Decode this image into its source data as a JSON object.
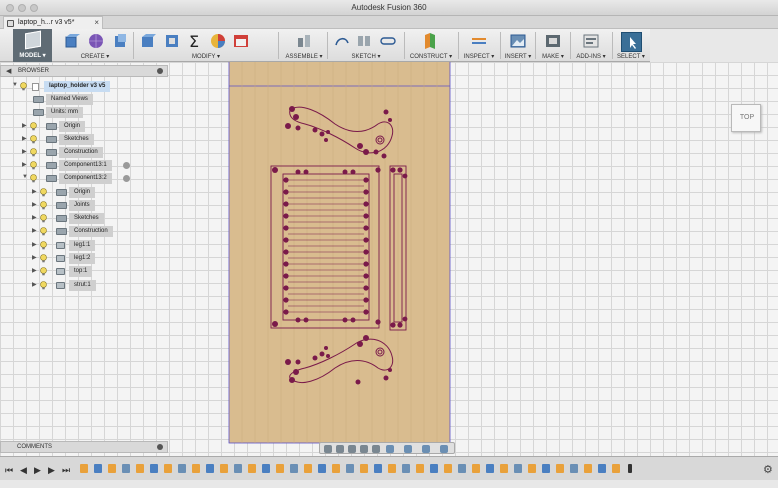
{
  "window": {
    "title": "Autodesk Fusion 360"
  },
  "tabs": [
    {
      "label": "laptop_h...r v3 v5*",
      "close": "×"
    }
  ],
  "toolbar": {
    "workspace": "MODEL ▾",
    "groups": [
      {
        "label": "CREATE ▾"
      },
      {
        "label": "MODIFY ▾"
      },
      {
        "label": "ASSEMBLE ▾"
      },
      {
        "label": "SKETCH ▾"
      },
      {
        "label": "CONSTRUCT ▾"
      },
      {
        "label": "INSPECT ▾"
      },
      {
        "label": "INSERT ▾"
      },
      {
        "label": "MAKE ▾"
      },
      {
        "label": "ADD-INS ▾"
      },
      {
        "label": "SELECT ▾"
      }
    ]
  },
  "browser": {
    "title": "BROWSER",
    "root": "laptop_holder v3 v5",
    "items": [
      {
        "label": "Named Views"
      },
      {
        "label": "Units: mm"
      },
      {
        "label": "Origin"
      },
      {
        "label": "Sketches"
      },
      {
        "label": "Construction"
      },
      {
        "label": "Component13:1"
      },
      {
        "label": "Component13:2"
      },
      {
        "label": "Origin"
      },
      {
        "label": "Joints"
      },
      {
        "label": "Sketches"
      },
      {
        "label": "Construction"
      },
      {
        "label": "leg1:1"
      },
      {
        "label": "leg1:2"
      },
      {
        "label": "top:1"
      },
      {
        "label": "strut:1"
      }
    ]
  },
  "viewcube": {
    "face": "TOP"
  },
  "comments": {
    "title": "COMMENTS"
  },
  "colors": {
    "sheet": "#d9bc8f",
    "sketch": "#7a1a4a",
    "accent": "#3a6f97",
    "grid": "#d6d6d6"
  },
  "icons": {
    "timeline": [
      "go-to-start-icon",
      "step-back-icon",
      "play-icon",
      "step-forward-icon",
      "go-to-end-icon",
      "settings-gear-icon"
    ]
  }
}
